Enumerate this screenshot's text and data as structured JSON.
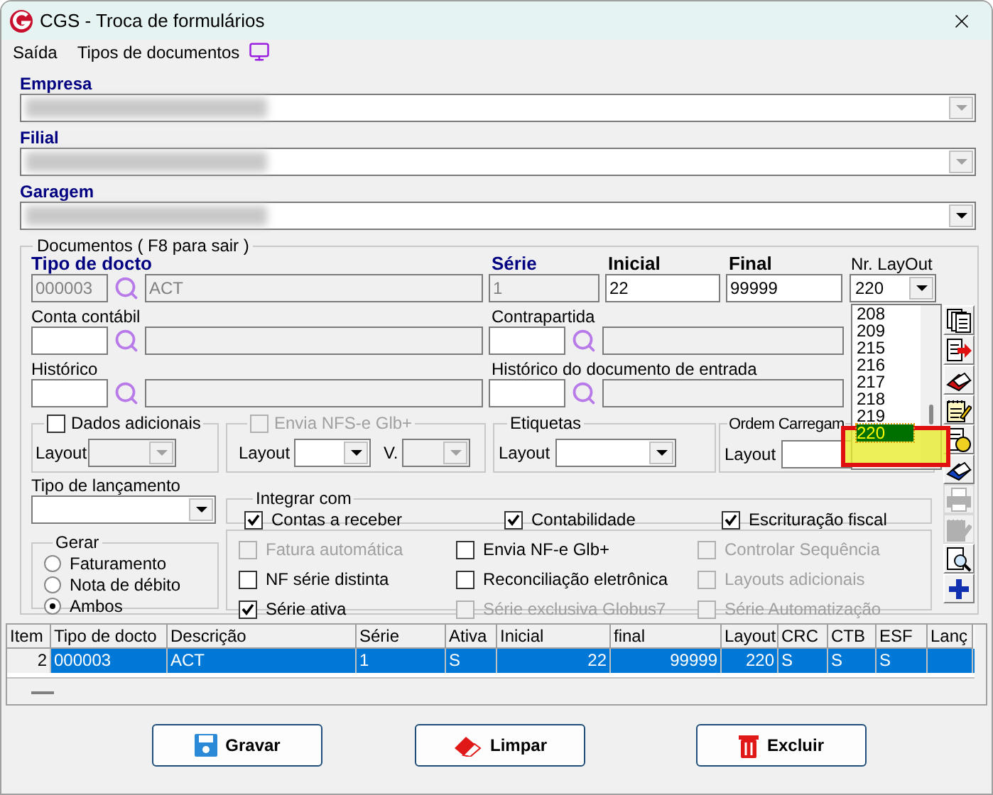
{
  "window": {
    "title": "CGS - Troca de formulários"
  },
  "menu": [
    {
      "label": "Saída"
    },
    {
      "label": "Tipos de documentos"
    }
  ],
  "selectors": [
    {
      "label": "Empresa",
      "enabled": false
    },
    {
      "label": "Filial",
      "enabled": false
    },
    {
      "label": "Garagem",
      "enabled": true
    }
  ],
  "documents": {
    "title": "Documentos ( F8 para sair )",
    "tipo_docto": {
      "label": "Tipo de docto",
      "code": "000003",
      "description": "ACT"
    },
    "serie": {
      "label": "Série",
      "value": "1"
    },
    "inicial": {
      "label": "Inicial",
      "value": "22"
    },
    "final": {
      "label": "Final",
      "value": "99999"
    },
    "nr_layout": {
      "label": "Nr. LayOut",
      "value": "220",
      "options": [
        {
          "label": "208",
          "selected": false
        },
        {
          "label": "209",
          "selected": false
        },
        {
          "label": "215",
          "selected": false
        },
        {
          "label": "216",
          "selected": false
        },
        {
          "label": "217",
          "selected": false
        },
        {
          "label": "218",
          "selected": false
        },
        {
          "label": "219",
          "selected": false
        },
        {
          "label": "220",
          "selected": true
        }
      ]
    },
    "conta_contabil": {
      "label": "Conta contábil"
    },
    "contrapartida": {
      "label": "Contrapartida"
    },
    "historico": {
      "label": "Histórico"
    },
    "historico_entrada": {
      "label": "Histórico do documento de entrada"
    },
    "dados_adicionais": {
      "label": "Dados adicionais",
      "checked": false,
      "layout_label": "Layout"
    },
    "envia_nfse": {
      "label": "Envia NFS-e Glb+",
      "checked": false,
      "disabled": true,
      "layout_label": "Layout",
      "version_label": "V."
    },
    "etiquetas": {
      "title": "Etiquetas",
      "layout_label": "Layout"
    },
    "ordem": {
      "title": "Ordem Carregam",
      "layout_label": "Layout"
    },
    "tipo_lancamento": {
      "label": "Tipo de lançamento"
    },
    "integrar": {
      "title": "Integrar com",
      "options": [
        {
          "label": "Contas a receber",
          "checked": true
        },
        {
          "label": "Contabilidade",
          "checked": true
        },
        {
          "label": "Escrituração fiscal",
          "checked": true
        }
      ]
    },
    "gerar": {
      "title": "Gerar",
      "options": [
        {
          "label": "Faturamento",
          "selected": false
        },
        {
          "label": "Nota de débito",
          "selected": false
        },
        {
          "label": "Ambos",
          "selected": true
        }
      ]
    },
    "flags": [
      {
        "label": "Fatura automática",
        "checked": false,
        "disabled": true
      },
      {
        "label": "Envia NF-e Glb+",
        "checked": false,
        "disabled": false
      },
      {
        "label": "Controlar Sequência",
        "checked": false,
        "disabled": true
      },
      {
        "label": "NF série distinta",
        "checked": false,
        "disabled": false
      },
      {
        "label": "Reconciliação eletrônica",
        "checked": false,
        "disabled": false
      },
      {
        "label": "Layouts adicionais",
        "checked": false,
        "disabled": true
      },
      {
        "label": "Série ativa",
        "checked": true,
        "disabled": false
      },
      {
        "label": "Série exclusiva Globus7",
        "checked": false,
        "disabled": true
      },
      {
        "label": "Série Automatização",
        "checked": false,
        "disabled": true
      }
    ],
    "toolbar": [
      {
        "kind": "documents",
        "disabled": false
      },
      {
        "kind": "export",
        "disabled": false
      },
      {
        "kind": "eraser-red",
        "disabled": false
      },
      {
        "kind": "notepad",
        "disabled": false
      },
      {
        "kind": "report",
        "disabled": false
      },
      {
        "kind": "eraser-blue",
        "disabled": false
      },
      {
        "kind": "printer",
        "disabled": true
      },
      {
        "kind": "notepad",
        "disabled": true
      },
      {
        "kind": "preview",
        "disabled": false
      },
      {
        "kind": "plus",
        "disabled": false
      }
    ]
  },
  "table": {
    "columns": [
      "Item",
      "Tipo de docto",
      "Descrição",
      "Série",
      "Ativa",
      "Inicial",
      "final",
      "Layout",
      "CRC",
      "CTB",
      "ESF",
      "Lanç"
    ],
    "rows": [
      {
        "selected": true,
        "cells": [
          "2",
          "000003",
          "ACT",
          "1",
          "S",
          "22",
          "99999",
          "220",
          "S",
          "S",
          "S",
          ""
        ]
      }
    ]
  },
  "buttons": [
    {
      "label": "Gravar",
      "kind": "save"
    },
    {
      "label": "Limpar",
      "kind": "clear"
    },
    {
      "label": "Excluir",
      "kind": "delete"
    }
  ]
}
